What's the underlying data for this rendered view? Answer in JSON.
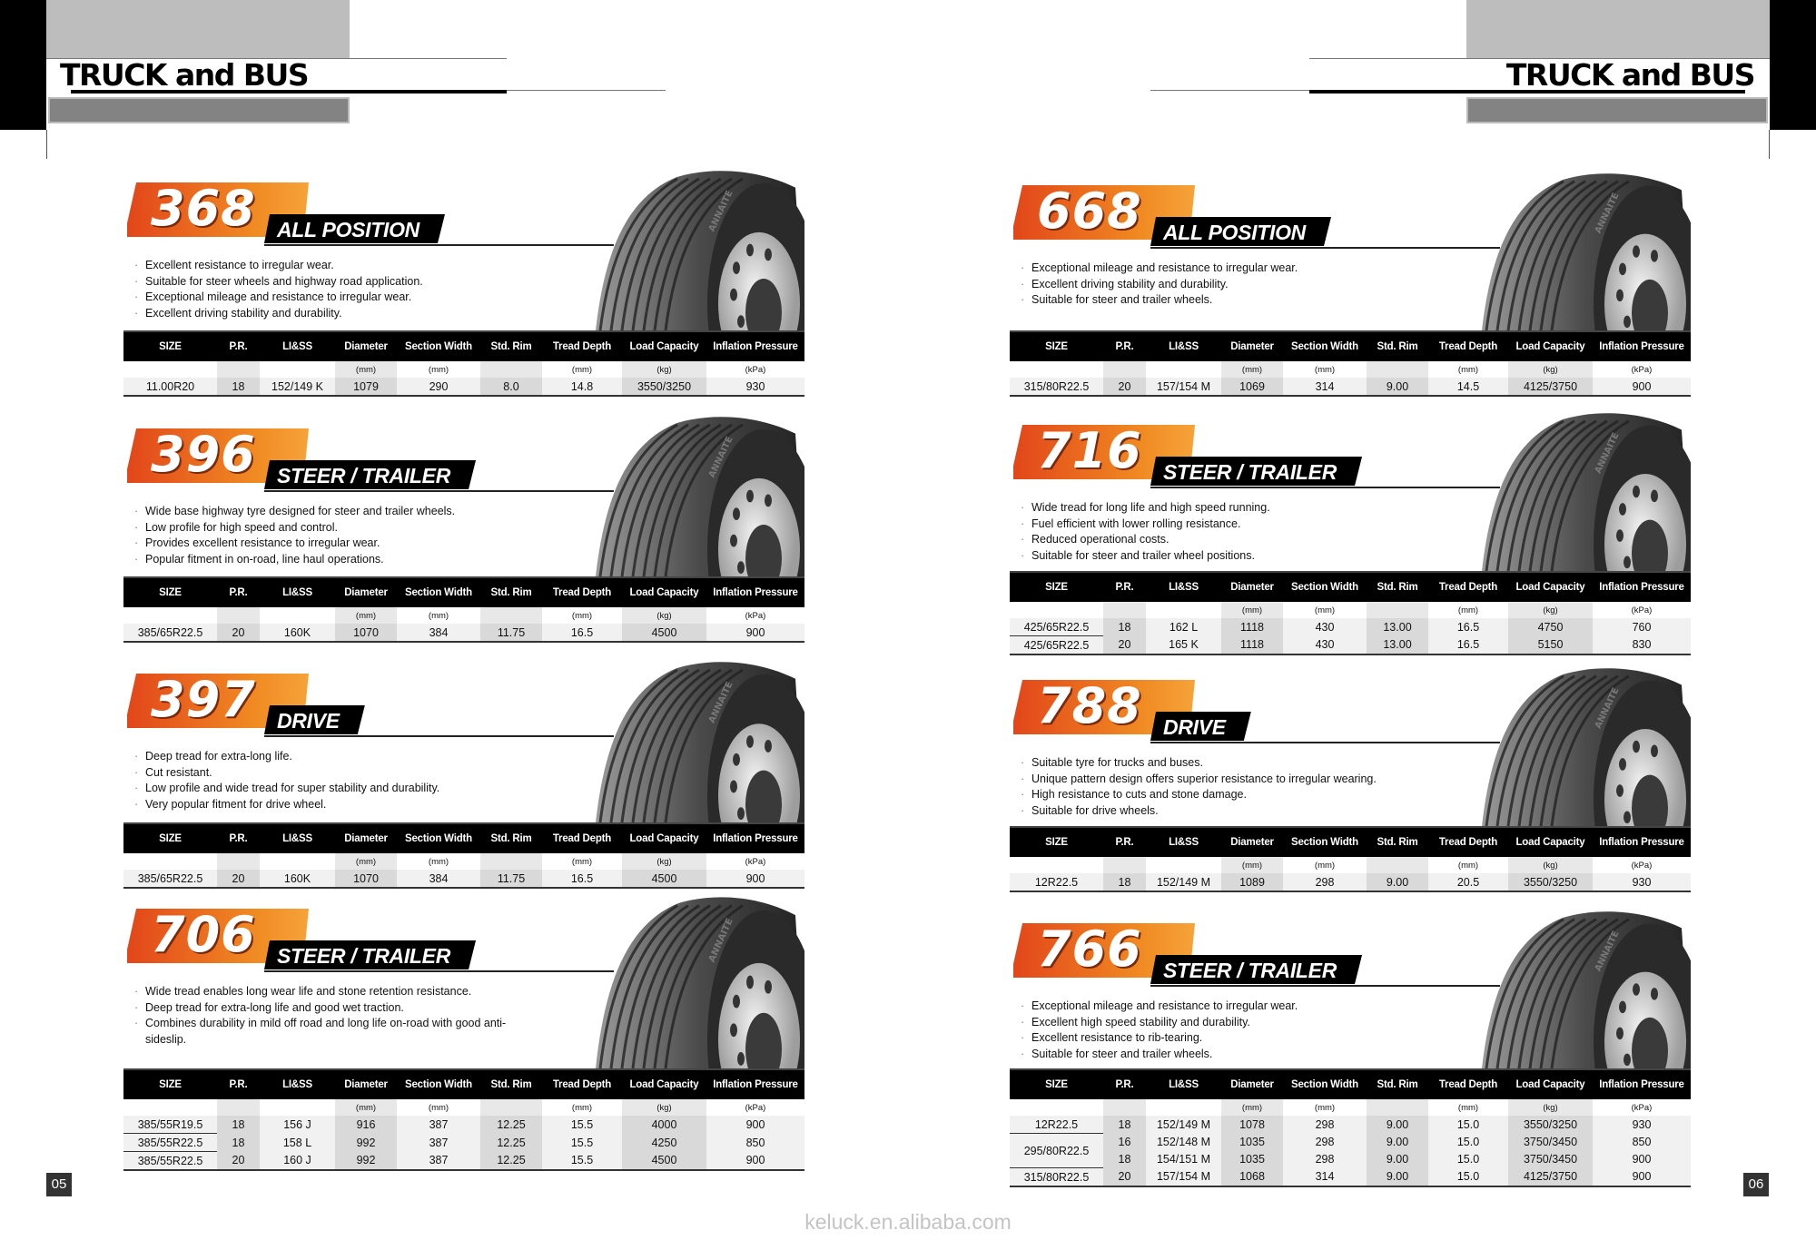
{
  "header": {
    "left_title": "TRUCK and BUS",
    "right_title": "TRUCK and BUS"
  },
  "table_headers": [
    "SIZE",
    "P.R.",
    "LI&SS",
    "Diameter",
    "Section Width",
    "Std. Rim",
    "Tread Depth",
    "Load Capacity",
    "Inflation Pressure"
  ],
  "table_units": [
    "",
    "",
    "",
    "(mm)",
    "(mm)",
    "",
    "(mm)",
    "(kg)",
    "(kPa)"
  ],
  "colors": {
    "badge_orange": "#e8531c",
    "badge_orange_light": "#f39323",
    "header_black": "#000000",
    "shade_grey": "#d9d9d9"
  },
  "tire_brand": "ANNAITE",
  "left_page": {
    "page_number": "05",
    "products": [
      {
        "model": "368",
        "position": "ALL POSITION",
        "features": [
          "Excellent resistance to irregular wear.",
          "Suitable for steer wheels and highway road application.",
          "Exceptional mileage and resistance to irregular wear.",
          "Excellent driving stability and durability."
        ],
        "rows": [
          [
            "11.00R20",
            "18",
            "152/149 K",
            "1079",
            "290",
            "8.0",
            "14.8",
            "3550/3250",
            "930"
          ]
        ]
      },
      {
        "model": "396",
        "position": "STEER / TRAILER",
        "features": [
          "Wide base highway tyre designed for steer and trailer wheels.",
          "Low profile for high speed and control.",
          "Provides excellent resistance to irregular wear.",
          "Popular fitment in on-road, line haul operations."
        ],
        "rows": [
          [
            "385/65R22.5",
            "20",
            "160K",
            "1070",
            "384",
            "11.75",
            "16.5",
            "4500",
            "900"
          ]
        ]
      },
      {
        "model": "397",
        "position": "DRIVE",
        "features": [
          "Deep tread for extra-long life.",
          "Cut resistant.",
          "Low profile and wide tread for super stability and durability.",
          "Very popular fitment for drive wheel."
        ],
        "rows": [
          [
            "385/65R22.5",
            "20",
            "160K",
            "1070",
            "384",
            "11.75",
            "16.5",
            "4500",
            "900"
          ]
        ]
      },
      {
        "model": "706",
        "position": "STEER / TRAILER",
        "features": [
          "Wide tread enables long wear life and stone retention resistance.",
          "Deep tread for extra-long life and good wet traction.",
          "Combines durability in mild off road and long life on-road with good anti-sideslip."
        ],
        "rows": [
          [
            "385/55R19.5",
            "18",
            "156 J",
            "916",
            "387",
            "12.25",
            "15.5",
            "4000",
            "900"
          ],
          [
            "385/55R22.5",
            "18",
            "158 L",
            "992",
            "387",
            "12.25",
            "15.5",
            "4250",
            "850"
          ],
          [
            "385/55R22.5",
            "20",
            "160 J",
            "992",
            "387",
            "12.25",
            "15.5",
            "4500",
            "900"
          ]
        ]
      }
    ]
  },
  "right_page": {
    "page_number": "06",
    "products": [
      {
        "model": "668",
        "position": "ALL POSITION",
        "features": [
          "Exceptional mileage and resistance to irregular wear.",
          "Excellent driving stability and durability.",
          "Suitable for steer and trailer wheels."
        ],
        "rows": [
          [
            "315/80R22.5",
            "20",
            "157/154 M",
            "1069",
            "314",
            "9.00",
            "14.5",
            "4125/3750",
            "900"
          ]
        ]
      },
      {
        "model": "716",
        "position": "STEER / TRAILER",
        "features": [
          "Wide tread for long life and high speed running.",
          "Fuel efficient with lower rolling resistance.",
          "Reduced operational costs.",
          "Suitable for steer and trailer wheel positions."
        ],
        "rows": [
          [
            "425/65R22.5",
            "18",
            "162 L",
            "1118",
            "430",
            "13.00",
            "16.5",
            "4750",
            "760"
          ],
          [
            "425/65R22.5",
            "20",
            "165 K",
            "1118",
            "430",
            "13.00",
            "16.5",
            "5150",
            "830"
          ]
        ]
      },
      {
        "model": "788",
        "position": "DRIVE",
        "features": [
          "Suitable tyre for trucks and buses.",
          "Unique pattern design offers superior resistance to irregular wearing.",
          "High resistance to cuts and stone damage.",
          "Suitable for drive wheels."
        ],
        "rows": [
          [
            "12R22.5",
            "18",
            "152/149 M",
            "1089",
            "298",
            "9.00",
            "20.5",
            "3550/3250",
            "930"
          ]
        ]
      },
      {
        "model": "766",
        "position": "STEER / TRAILER",
        "features": [
          "Exceptional mileage and resistance to irregular wear.",
          "Excellent high speed stability and durability.",
          "Excellent resistance to rib-tearing.",
          "Suitable for steer and trailer wheels."
        ],
        "rows": [
          [
            "12R22.5",
            "18",
            "152/149 M",
            "1078",
            "298",
            "9.00",
            "15.0",
            "3550/3250",
            "930"
          ],
          [
            "295/80R22.5",
            "16",
            "152/148 M",
            "1035",
            "298",
            "9.00",
            "15.0",
            "3750/3450",
            "850"
          ],
          [
            null,
            "18",
            "154/151 M",
            "1035",
            "298",
            "9.00",
            "15.0",
            "3750/3450",
            "900"
          ],
          [
            "315/80R22.5",
            "20",
            "157/154 M",
            "1068",
            "314",
            "9.00",
            "15.0",
            "4125/3750",
            "900"
          ]
        ]
      }
    ]
  },
  "watermark": "keluck.en.alibaba.com"
}
